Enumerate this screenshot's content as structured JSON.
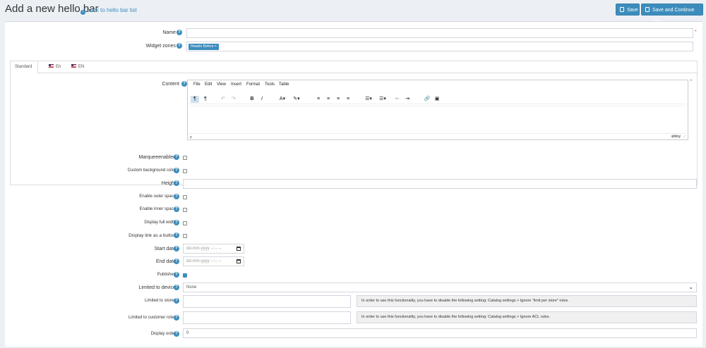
{
  "header": {
    "title": "Add a new hello bar",
    "back_link": "back to hello bar list",
    "save_label": "Save",
    "save_continue_label": "Save and Continue Edit"
  },
  "form": {
    "name_label": "Name",
    "name_value": "",
    "widget_zones_label": "Widget zones",
    "widget_zone_tag": "Header Before",
    "widget_zone_tag_remove": "×",
    "tabs": [
      {
        "label": "Standard"
      },
      {
        "label": "Eh"
      },
      {
        "label": "EN"
      }
    ],
    "content_label": "Content",
    "editor": {
      "menu": [
        "File",
        "Edit",
        "View",
        "Insert",
        "Format",
        "Tools",
        "Table"
      ],
      "path": "p",
      "brand": "tiny"
    },
    "marquee_label": "Marqueeenabled",
    "custom_bg_label": "Custom background color",
    "height_label": "Height",
    "outer_space_label": "Enable outer space",
    "inner_space_label": "Enable inner space",
    "full_width_label": "Display full width",
    "link_button_label": "Display link as a button",
    "start_date_label": "Start date",
    "start_date_placeholder": "dd-mm-yyyy --:-- --",
    "end_date_label": "End date",
    "end_date_placeholder": "dd-mm-yyyy --:-- --",
    "published_label": "Published",
    "published_checked": true,
    "device_label": "Limited to device",
    "device_value": "None",
    "stores_label": "Limited to stores",
    "stores_note": "In order to use this functionality, you have to disable the following setting: Catalog settings > Ignore \"limit per store\" rules.",
    "customer_roles_label": "Limited to customer roles",
    "customer_roles_note": "In order to use this functionality, you have to disable the following setting: Catalog settings > Ignore ACL rules.",
    "display_order_label": "Display order",
    "display_order_value": "0"
  },
  "colors": {
    "accent": "#3c8dbc",
    "background": "#ecf0f5",
    "required": "#dd4b39"
  }
}
